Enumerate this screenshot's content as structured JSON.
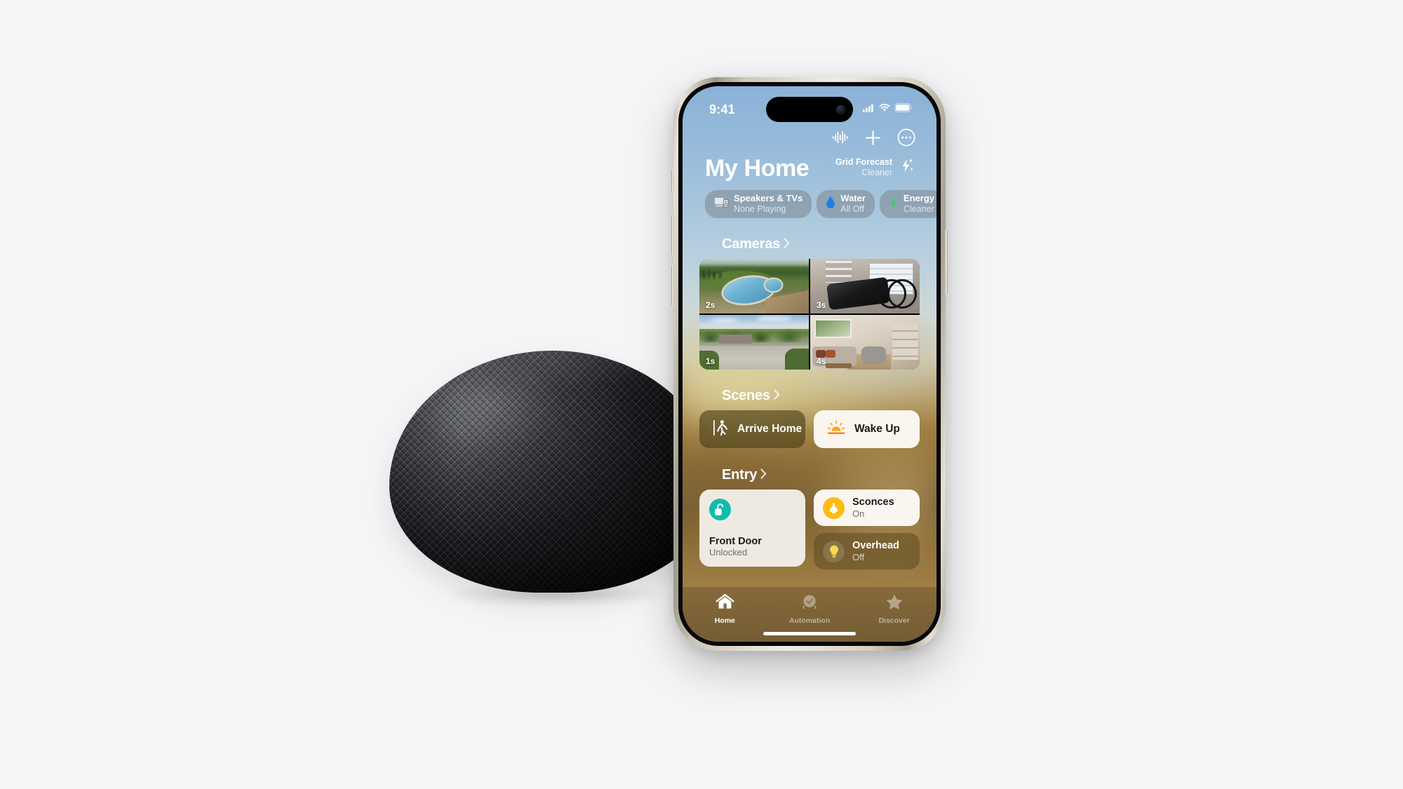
{
  "scene": {
    "background_color": "#f5f5f7",
    "device_left": "HomePod mini (midnight)",
    "device_right": "iPhone showing Apple Home app"
  },
  "statusbar": {
    "time": "9:41",
    "cellular_icon": "cellular-signal-icon",
    "wifi_icon": "wifi-icon",
    "battery_icon": "battery-icon"
  },
  "header": {
    "title": "My Home",
    "icons": {
      "waveform": "waveform-icon",
      "add": "plus-icon",
      "more": "ellipsis-circle-icon"
    },
    "grid_forecast": {
      "title": "Grid Forecast",
      "subtitle": "Cleaner",
      "icon": "clean-energy-bolt-icon"
    }
  },
  "pills": [
    {
      "icon": "speaker-tv-icon",
      "title": "Speakers & TVs",
      "subtitle": "None Playing"
    },
    {
      "icon": "water-drop-icon",
      "title": "Water",
      "subtitle": "All Off",
      "color": "#1a7fe8"
    },
    {
      "icon": "energy-bolt-icon",
      "title": "Energy",
      "subtitle": "Cleaner",
      "color": "#2fd463"
    }
  ],
  "sections": {
    "cameras": {
      "title": "Cameras",
      "chevron": "chevron-right-icon",
      "tiles": [
        {
          "label": "2s",
          "name": "pool-camera"
        },
        {
          "label": "3s",
          "name": "garage-camera"
        },
        {
          "label": "1s",
          "name": "driveway-camera"
        },
        {
          "label": "4s",
          "name": "living-room-camera"
        }
      ]
    },
    "scenes": {
      "title": "Scenes",
      "chevron": "chevron-right-icon",
      "tiles": [
        {
          "label": "Arrive Home",
          "icon": "walking-person-icon",
          "state": "inactive"
        },
        {
          "label": "Wake Up",
          "icon": "sunrise-icon",
          "state": "active"
        }
      ]
    },
    "entry": {
      "title": "Entry",
      "chevron": "chevron-right-icon",
      "tiles": [
        {
          "name": "front-door-lock",
          "label": "Front Door",
          "status": "Unlocked",
          "icon": "unlocked-padlock-icon",
          "icon_color": "#0dbdb0",
          "state": "on"
        },
        {
          "name": "sconces-light",
          "label": "Sconces",
          "status": "On",
          "icon": "sconce-lamp-icon",
          "icon_color": "#fcbc14",
          "state": "on"
        },
        {
          "name": "overhead-light",
          "label": "Overhead",
          "status": "Off",
          "icon": "lightbulb-icon",
          "icon_color": "#fcd94a",
          "state": "off"
        }
      ]
    }
  },
  "tabbar": [
    {
      "label": "Home",
      "icon": "house-icon",
      "active": true
    },
    {
      "label": "Automation",
      "icon": "clock-check-icon",
      "active": false
    },
    {
      "label": "Discover",
      "icon": "star-icon",
      "active": false
    }
  ]
}
